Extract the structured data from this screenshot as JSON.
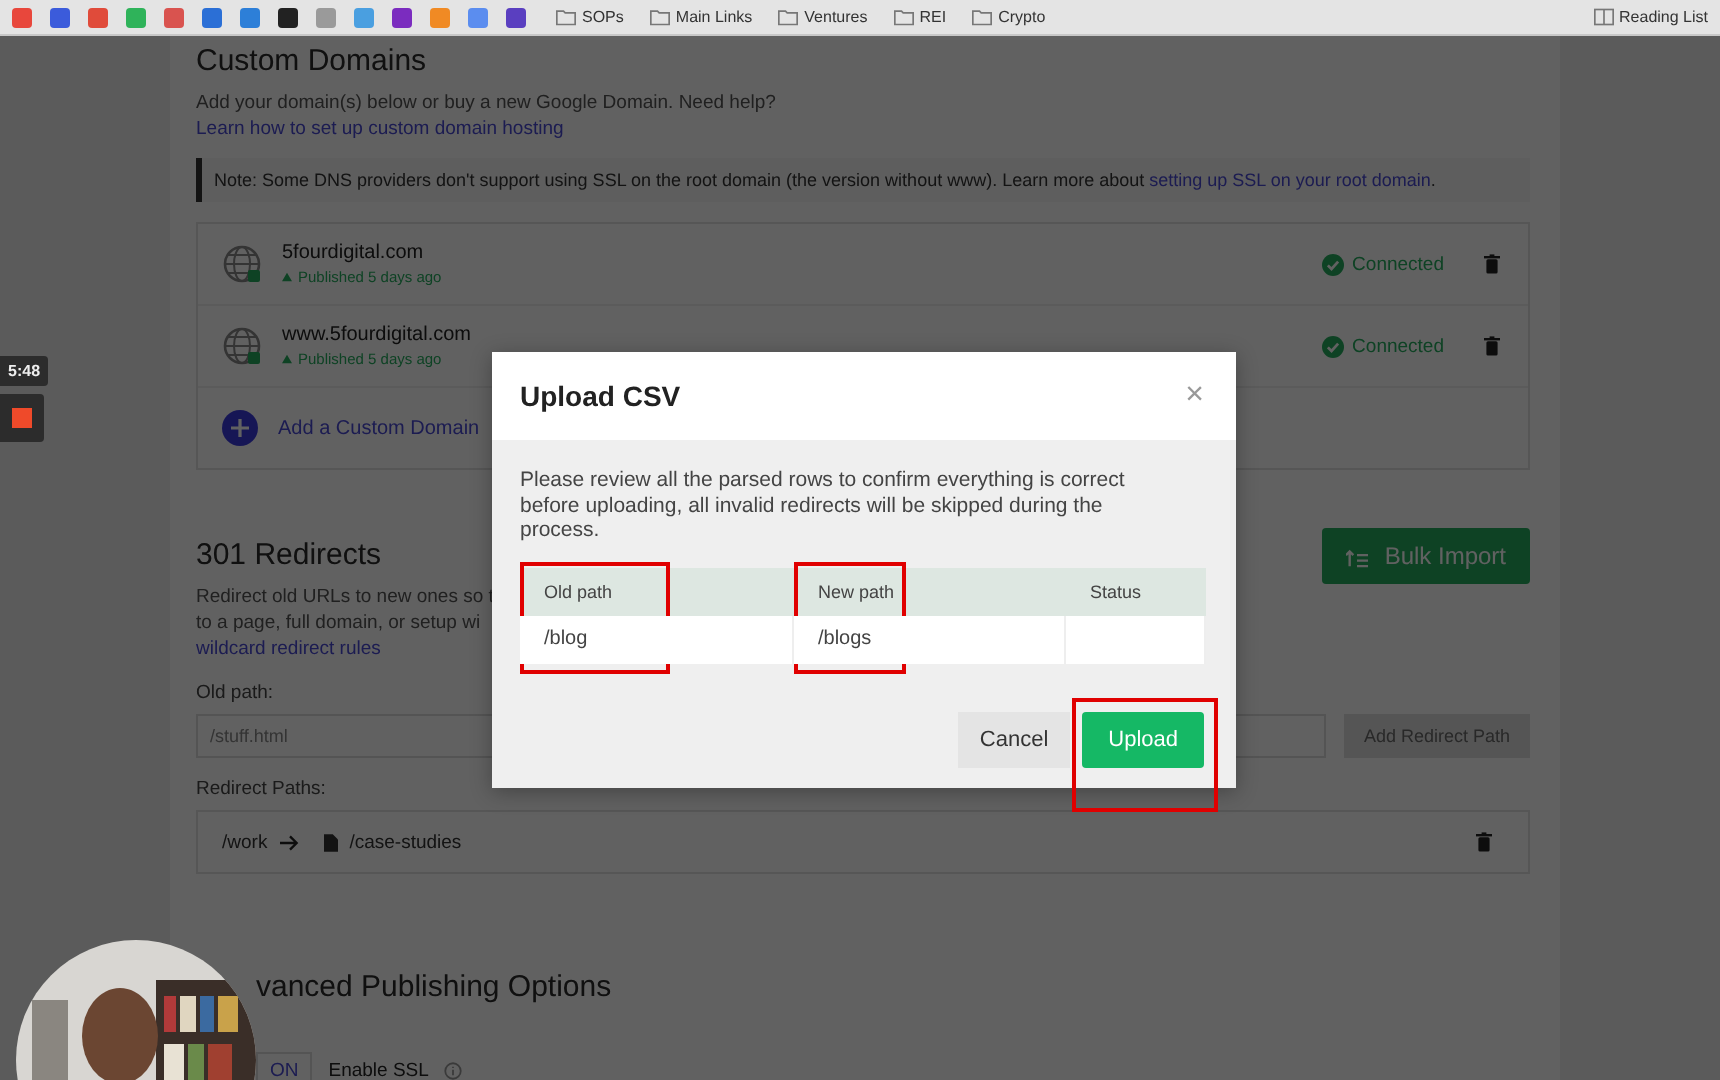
{
  "bookmarks_bar": {
    "folders": [
      "SOPs",
      "Main Links",
      "Ventures",
      "REI",
      "Crypto"
    ],
    "reading_list": "Reading List"
  },
  "recorder": {
    "time": "5:48"
  },
  "custom_domains": {
    "title": "Custom Domains",
    "description": "Add your domain(s) below or buy a new Google Domain. Need help?",
    "help_link": "Learn how to set up custom domain hosting",
    "note": "Note: Some DNS providers don't support using SSL on the root domain (the version without www). Learn more about",
    "note_link": "setting up SSL on your root domain",
    "note_end": ".",
    "domains": [
      {
        "name": "5fourdigital.com",
        "published": "Published 5 days ago",
        "status": "Connected"
      },
      {
        "name": "www.5fourdigital.com",
        "published": "Published 5 days ago",
        "status": "Connected"
      }
    ],
    "add_label": "Add a Custom Domain"
  },
  "redirects": {
    "title": "301 Redirects",
    "description_lines": [
      "Redirect old URLs to new ones so t",
      "to a page, full domain, or setup wi"
    ],
    "rules_link": "wildcard redirect rules",
    "bulk_import": "Bulk Import",
    "old_path_label": "Old path:",
    "old_path_value": "/stuff.html",
    "add_button": "Add Redirect Path",
    "paths_label": "Redirect Paths:",
    "paths": [
      {
        "from": "/work",
        "to": "/case-studies"
      }
    ]
  },
  "advanced": {
    "title": "vanced Publishing Options",
    "toggle": "ON",
    "ssl_label": "Enable SSL"
  },
  "modal": {
    "title": "Upload CSV",
    "close": "×",
    "message": "Please review all the parsed rows to confirm everything is correct before uploading, all invalid redirects will be skipped during the process.",
    "columns": [
      {
        "label": "Old path",
        "highlighted": true
      },
      {
        "label": "New path",
        "highlighted": true
      },
      {
        "label": "Status",
        "highlighted": false
      }
    ],
    "rows": [
      {
        "old_path": "/blog",
        "new_path": "/blogs"
      }
    ],
    "cancel": "Cancel",
    "upload": {
      "label": "Upload",
      "highlighted": true
    }
  }
}
